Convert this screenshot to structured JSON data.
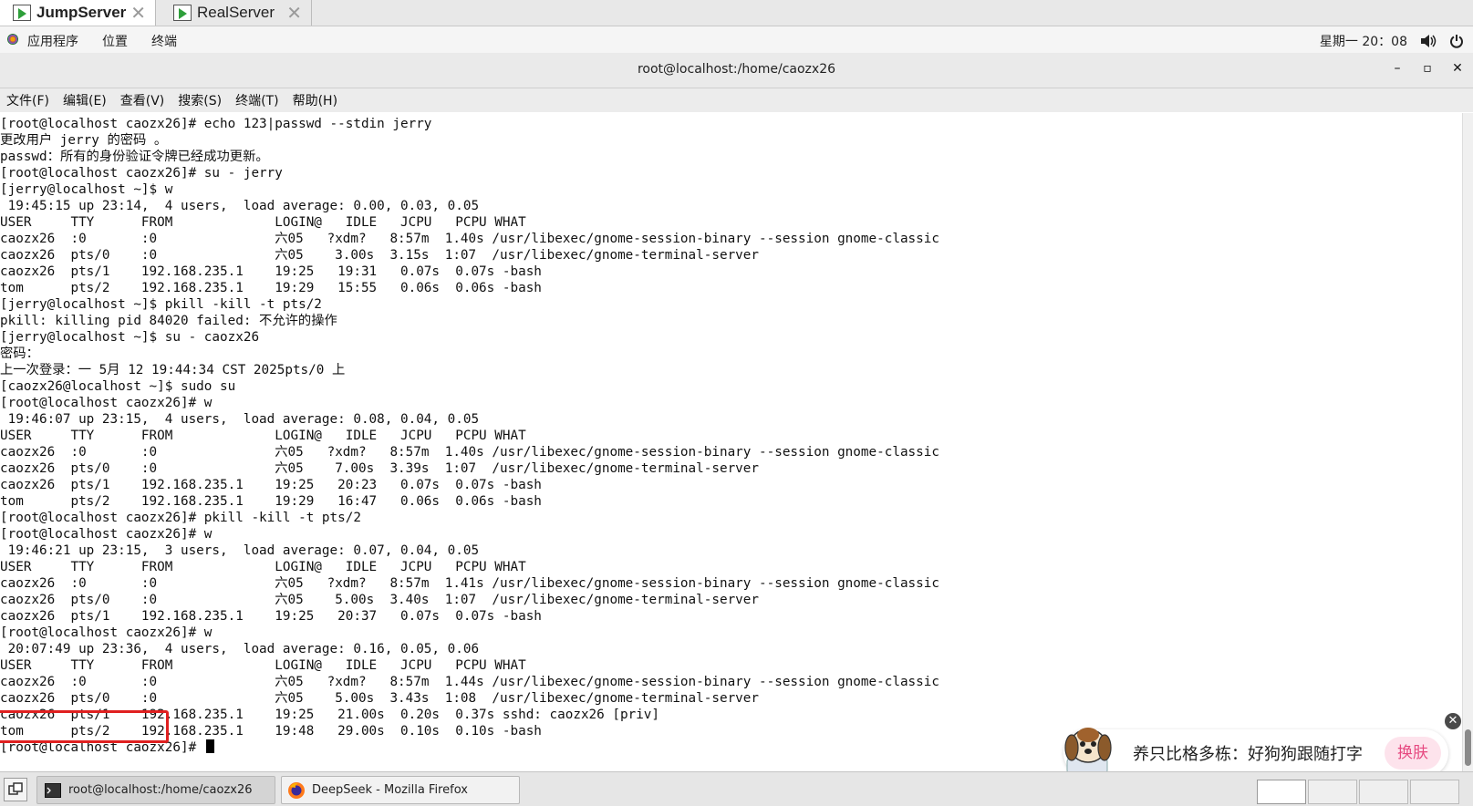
{
  "vm_tabs": [
    {
      "label": "JumpServer",
      "close": "✕"
    },
    {
      "label": "RealServer",
      "close": "✕"
    }
  ],
  "panel": {
    "apps": "应用程序",
    "places": "位置",
    "terminal": "终端",
    "clock": "星期一 20：08",
    "volume_icon": "volume-icon",
    "power_icon": "power-icon"
  },
  "window": {
    "title": "root@localhost:/home/caozx26",
    "minimize": "–",
    "maximize": "▫",
    "close": "✕"
  },
  "menubar": [
    "文件(F)",
    "编辑(E)",
    "查看(V)",
    "搜索(S)",
    "终端(T)",
    "帮助(H)"
  ],
  "terminal_lines": [
    "[root@localhost caozx26]# echo 123|passwd --stdin jerry",
    "更改用户 jerry 的密码 。",
    "passwd：所有的身份验证令牌已经成功更新。",
    "[root@localhost caozx26]# su - jerry",
    "[jerry@localhost ~]$ w",
    " 19:45:15 up 23:14,  4 users,  load average: 0.00, 0.03, 0.05",
    "USER     TTY      FROM             LOGIN@   IDLE   JCPU   PCPU WHAT",
    "caozx26  :0       :0               六05   ?xdm?   8:57m  1.40s /usr/libexec/gnome-session-binary --session gnome-classic",
    "caozx26  pts/0    :0               六05    3.00s  3.15s  1:07  /usr/libexec/gnome-terminal-server",
    "caozx26  pts/1    192.168.235.1    19:25   19:31   0.07s  0.07s -bash",
    "tom      pts/2    192.168.235.1    19:29   15:55   0.06s  0.06s -bash",
    "[jerry@localhost ~]$ pkill -kill -t pts/2",
    "pkill: killing pid 84020 failed: 不允许的操作",
    "[jerry@localhost ~]$ su - caozx26",
    "密码：",
    "上一次登录：一 5月 12 19:44:34 CST 2025pts/0 上",
    "[caozx26@localhost ~]$ sudo su",
    "[root@localhost caozx26]# w",
    " 19:46:07 up 23:15,  4 users,  load average: 0.08, 0.04, 0.05",
    "USER     TTY      FROM             LOGIN@   IDLE   JCPU   PCPU WHAT",
    "caozx26  :0       :0               六05   ?xdm?   8:57m  1.40s /usr/libexec/gnome-session-binary --session gnome-classic",
    "caozx26  pts/0    :0               六05    7.00s  3.39s  1:07  /usr/libexec/gnome-terminal-server",
    "caozx26  pts/1    192.168.235.1    19:25   20:23   0.07s  0.07s -bash",
    "tom      pts/2    192.168.235.1    19:29   16:47   0.06s  0.06s -bash",
    "[root@localhost caozx26]# pkill -kill -t pts/2",
    "[root@localhost caozx26]# w",
    " 19:46:21 up 23:15,  3 users,  load average: 0.07, 0.04, 0.05",
    "USER     TTY      FROM             LOGIN@   IDLE   JCPU   PCPU WHAT",
    "caozx26  :0       :0               六05   ?xdm?   8:57m  1.41s /usr/libexec/gnome-session-binary --session gnome-classic",
    "caozx26  pts/0    :0               六05    5.00s  3.40s  1:07  /usr/libexec/gnome-terminal-server",
    "caozx26  pts/1    192.168.235.1    19:25   20:37   0.07s  0.07s -bash",
    "[root@localhost caozx26]# w",
    " 20:07:49 up 23:36,  4 users,  load average: 0.16, 0.05, 0.06",
    "USER     TTY      FROM             LOGIN@   IDLE   JCPU   PCPU WHAT",
    "caozx26  :0       :0               六05   ?xdm?   8:57m  1.44s /usr/libexec/gnome-session-binary --session gnome-classic",
    "caozx26  pts/0    :0               六05    5.00s  3.43s  1:08  /usr/libexec/gnome-terminal-server",
    "caozx26  pts/1    192.168.235.1    19:25   21.00s  0.20s  0.37s sshd: caozx26 [priv]",
    "tom      pts/2    192.168.235.1    19:48   29.00s  0.10s  0.10s -bash"
  ],
  "prompt": "[root@localhost caozx26]# ",
  "ad": {
    "text": "养只比格多栋：好狗狗跟随打字",
    "button": "换肤",
    "close": "✕"
  },
  "taskbar": {
    "items": [
      {
        "label": "root@localhost:/home/caozx26",
        "icon": "terminal-icon"
      },
      {
        "label": "DeepSeek - Mozilla Firefox",
        "icon": "firefox-icon"
      }
    ]
  },
  "colors": {
    "annotation_red": "#e02020",
    "ad_button_text": "#e64980"
  }
}
